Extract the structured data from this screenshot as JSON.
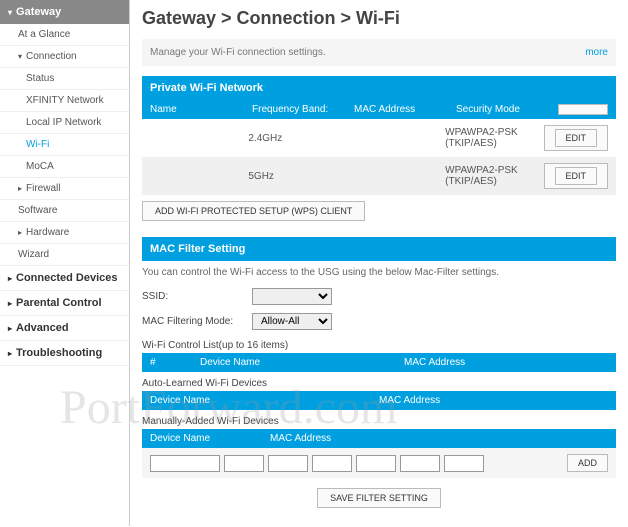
{
  "breadcrumb": "Gateway > Connection > Wi-Fi",
  "desc": "Manage your Wi-Fi connection settings.",
  "more": "more",
  "sidebar": {
    "gateway": "Gateway",
    "glance": "At a Glance",
    "connection": "Connection",
    "status": "Status",
    "xfinity": "XFINITY Network",
    "localip": "Local IP Network",
    "wifi": "Wi-Fi",
    "moca": "MoCA",
    "firewall": "Firewall",
    "software": "Software",
    "hardware": "Hardware",
    "wizard": "Wizard",
    "connected": "Connected Devices",
    "parental": "Parental Control",
    "advanced": "Advanced",
    "trouble": "Troubleshooting"
  },
  "private": {
    "title": "Private Wi-Fi Network",
    "cols": {
      "name": "Name",
      "freq": "Frequency Band:",
      "mac": "MAC Address",
      "sec": "Security Mode"
    },
    "rows": [
      {
        "name": "",
        "freq": "2.4GHz",
        "mac": "",
        "sec": "WPAWPA2-PSK (TKIP/AES)"
      },
      {
        "name": "",
        "freq": "5GHz",
        "mac": "",
        "sec": "WPAWPA2-PSK (TKIP/AES)"
      }
    ],
    "edit": "EDIT",
    "wps": "ADD WI-FI PROTECTED SETUP (WPS) CLIENT"
  },
  "macfilter": {
    "title": "MAC Filter Setting",
    "note": "You can control the Wi-Fi access to the USG using the below Mac-Filter settings.",
    "ssid_label": "SSID:",
    "mode_label": "MAC Filtering Mode:",
    "mode_value": "Allow-All",
    "controllist": "Wi-Fi Control List(up to 16 items)",
    "cols": {
      "idx": "#",
      "device": "Device Name",
      "mac": "MAC Address"
    },
    "autolearned": "Auto-Learned Wi-Fi Devices",
    "manual": "Manually-Added Wi-Fi Devices",
    "cols2": {
      "device": "Device Name",
      "mac": "MAC Address"
    },
    "add": "ADD",
    "save": "SAVE FILTER SETTING"
  },
  "watermark": "PortForward.com"
}
